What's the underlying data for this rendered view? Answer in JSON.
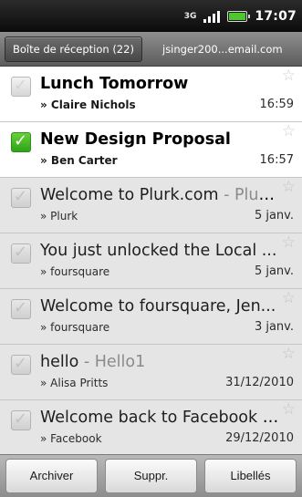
{
  "status_bar": {
    "network_type": "3G",
    "time": "17:07",
    "battery_color": "#4ec72e"
  },
  "header": {
    "folder_tab": "Boîte de réception (22)",
    "account": "jsinger200...email.com"
  },
  "messages": [
    {
      "subject": "Lunch Tomorrow",
      "preview": "",
      "sender": "» Claire Nichols",
      "date": "16:59",
      "read": false,
      "checked": false
    },
    {
      "subject": "New Design Proposal",
      "preview": "",
      "sender": "» Ben Carter",
      "date": "16:57",
      "read": false,
      "checked": true
    },
    {
      "subject": "Welcome to Plurk.com",
      "preview": " - Plurk....",
      "sender": "» Plurk",
      "date": "5 janv.",
      "read": true,
      "checked": false
    },
    {
      "subject": "You just unlocked the Local ...",
      "preview": "",
      "sender": "» foursquare",
      "date": "5 janv.",
      "read": true,
      "checked": false
    },
    {
      "subject": "Welcome to foursquare, Jen...",
      "preview": "",
      "sender": "» foursquare",
      "date": "3 janv.",
      "read": true,
      "checked": false
    },
    {
      "subject": "hello",
      "preview": " - Hello1",
      "sender": "» Alisa Pritts",
      "date": "31/12/2010",
      "read": true,
      "checked": false
    },
    {
      "subject": "Welcome back to Facebook",
      "preview": " - f...",
      "sender": "» Facebook",
      "date": "29/12/2010",
      "read": true,
      "checked": false
    }
  ],
  "actions": {
    "archive": "Archiver",
    "delete": "Suppr.",
    "labels": "Libellés"
  },
  "icons": {
    "checkbox_tick": "✓",
    "star": "☆"
  }
}
